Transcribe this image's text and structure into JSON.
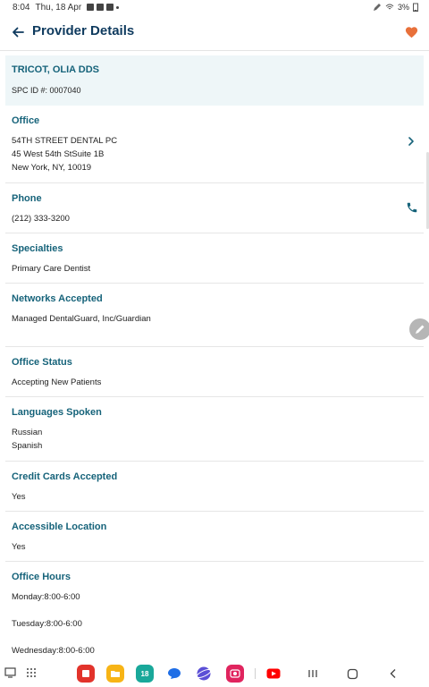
{
  "status_bar": {
    "time": "8:04",
    "date": "Thu, 18 Apr",
    "battery": "3%"
  },
  "header": {
    "title": "Provider Details",
    "back_icon": "arrow-left-icon",
    "favorite_icon": "heart-icon"
  },
  "provider": {
    "name": "TRICOT, OLIA DDS",
    "spc_id": "SPC ID #: 0007040"
  },
  "office": {
    "label": "Office",
    "lines": [
      "54TH STREET DENTAL PC",
      "45 West 54th StSuite 1B",
      "New York, NY, 10019"
    ]
  },
  "phone": {
    "label": "Phone",
    "number": "(212) 333-3200"
  },
  "specialties": {
    "label": "Specialties",
    "value": "Primary Care Dentist"
  },
  "networks": {
    "label": "Networks Accepted",
    "value": "Managed DentalGuard, Inc/Guardian"
  },
  "office_status": {
    "label": "Office Status",
    "value": "Accepting New Patients"
  },
  "languages": {
    "label": "Languages Spoken",
    "values": [
      "Russian",
      "Spanish"
    ]
  },
  "credit_cards": {
    "label": "Credit Cards Accepted",
    "value": "Yes"
  },
  "accessible": {
    "label": "Accessible Location",
    "value": "Yes"
  },
  "office_hours": {
    "label": "Office Hours",
    "lines": [
      "Monday:8:00-6:00",
      "Tuesday:8:00-6:00",
      "Wednesday:8:00-6:00"
    ]
  },
  "taskbar": {
    "calendar_day": "18"
  },
  "colors": {
    "accent": "#16637a",
    "title": "#0e3a5e",
    "heart": "#e8703a",
    "hero_bg": "#eef6f8"
  }
}
